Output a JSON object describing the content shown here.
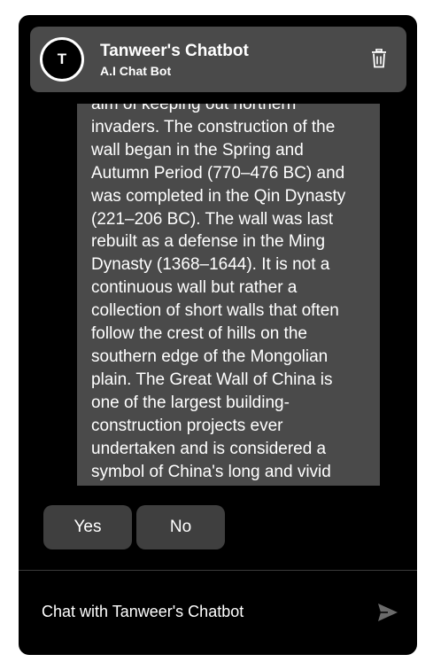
{
  "header": {
    "avatar_letter": "T",
    "title": "Tanweer's Chatbot",
    "subtitle": "A.I Chat Bot",
    "delete_icon": "trash-icon"
  },
  "messages": [
    {
      "role": "bot",
      "text": "aim of keeping out northern\ninvaders. The construction of the\nwall began in the Spring and\nAutumn Period (770–476 BC) and\nwas completed in the Qin Dynasty\n(221–206 BC). The wall was last\nrebuilt as a defense in the Ming\nDynasty (1368–1644). It is not a\ncontinuous wall but rather a\ncollection of short walls that often\nfollow the crest of hills on the\nsouthern edge of the Mongolian\nplain. The Great Wall of China is\none of the largest building-\nconstruction projects ever\nundertaken and is considered a\nsymbol of China's long and vivid"
    }
  ],
  "options": [
    {
      "label": "Yes"
    },
    {
      "label": "No"
    }
  ],
  "input": {
    "placeholder": "Chat with Tanweer's Chatbot",
    "send_icon": "send-icon"
  },
  "colors": {
    "window_bg": "#000000",
    "header_bg": "#4a4a4a",
    "bubble_bg": "#4a4a4a",
    "button_bg": "#3f3f3f",
    "text": "#ffffff",
    "send_icon": "#6b6b6b"
  }
}
